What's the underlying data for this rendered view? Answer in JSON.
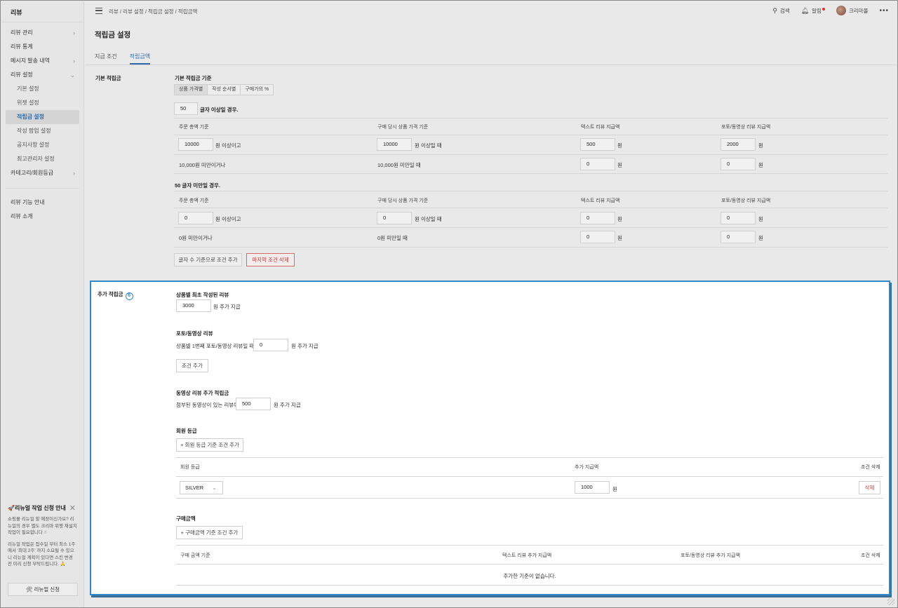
{
  "app": {
    "brand": "리뷰"
  },
  "sidebar": {
    "items": [
      {
        "label": "리뷰 관리",
        "chevron": "›"
      },
      {
        "label": "리뷰 통계"
      },
      {
        "label": "메시지 발송 내역",
        "chevron": "›"
      },
      {
        "label": "리뷰 설정",
        "chevron": "⌄"
      },
      {
        "label": "기본 설정"
      },
      {
        "label": "위젯 설정"
      },
      {
        "label": "적립금 설정"
      },
      {
        "label": "작성 팝업 설정"
      },
      {
        "label": "공지사항 설정"
      },
      {
        "label": "최고관리자 설정"
      },
      {
        "label": "카테고리/회원등급",
        "chevron": "›"
      }
    ],
    "bottom_items": [
      {
        "label": "리뷰 기능 안내"
      },
      {
        "label": "리뷰 소개"
      }
    ],
    "promo": {
      "title": "🚀리뉴얼 작업 신청 안내",
      "close": "✕",
      "text1": "쇼핑몰 리뉴얼 할 예정이신가요? 리뉴얼의 경우 별도 크리마 위젯 재설치 작업이 필요합니다 ☝",
      "text2": "리뉴얼 작업은 접수일 부터 최소 1주에서 '최대 2주' 까지 소요될 수 있으니 리뉴얼 계획이 있다면 스킨 변경 전 미리 신청 부탁드립니다. 🙏",
      "button": "🛠 리뉴얼 신청"
    }
  },
  "topbar": {
    "breadcrumb": "리뷰 / 리뷰 설정 / 적립금 설정 / 적립금액",
    "search": "검색",
    "alerts": "알림",
    "user": "크리마몰",
    "more": "•••"
  },
  "page": {
    "title": "적립금 설정",
    "tabs": [
      "지급 조건",
      "적립금액"
    ]
  },
  "basic": {
    "section_label": "기본 적립금",
    "criteria_title": "기본 적립금 기준",
    "segments": [
      "상품 가격별",
      "작성 순서별",
      "구매가의 %"
    ],
    "char_count": "50",
    "over_label": "글자 이상일 경우.",
    "under_label": "50 글자 미만일 경우.",
    "columns": [
      "주문 총액 기준",
      "구매 당시 상품 가격 기준",
      "텍스트 리뷰 지급액",
      "포토/동영상 리뷰 지급액"
    ],
    "over_rows": {
      "r1": {
        "order": "10000",
        "order_suffix": "원 이상이고",
        "price": "10000",
        "price_suffix": "원 이상일 때",
        "text": "500",
        "photo": "2000",
        "won": "원"
      },
      "r2": {
        "order_text": "10,000원 미만이거나",
        "price_text": "10,000원 미만일 때",
        "text": "0",
        "photo": "0",
        "won": "원"
      }
    },
    "under_rows": {
      "r1": {
        "order": "0",
        "order_suffix": "원 이상이고",
        "price": "0",
        "price_suffix": "원 이상일 때",
        "text": "0",
        "photo": "0",
        "won": "원"
      },
      "r2": {
        "order_text": "0원 미만이거나",
        "price_text": "0원 미만일 때",
        "text": "0",
        "photo": "0",
        "won": "원"
      }
    },
    "add_btn": "글자 수 기준으로 조건 추가",
    "delete_btn": "마지막 조건 삭제"
  },
  "extra": {
    "section_label": "추가 적립금",
    "badge": "6",
    "first_review": {
      "title": "상품별 최초 작성된 리뷰",
      "value": "3000",
      "suffix": "원 추가 지급"
    },
    "photo_review": {
      "title": "포토/동영상 리뷰",
      "prefix": "상품별 1번째 포토/동영상 리뷰일 때,",
      "value": "0",
      "suffix": "원 추가 지급",
      "add_btn": "조건 추가"
    },
    "video_review": {
      "title": "동영상 리뷰 추가 적립금",
      "prefix": "첨부된 동영상이 있는 리뷰에",
      "value": "500",
      "suffix": "원 추가 지급"
    },
    "member_grade": {
      "title": "회원 등급",
      "add_btn": "+ 회원 등급 기준 조건 추가",
      "columns": [
        "회원 등급",
        "추가 지급액",
        "조건 삭제"
      ],
      "row": {
        "grade": "SILVER",
        "amount": "1000",
        "won": "원",
        "delete": "삭제"
      }
    },
    "purchase": {
      "title": "구매금액",
      "add_btn": "+ 구매금액 기준 조건 추가",
      "columns": [
        "구매 금액 기준",
        "텍스트 리뷰 추가 지급액",
        "포토/동영상 리뷰 추가 지급액",
        "조건 삭제"
      ],
      "empty": "추가한 기준이 없습니다."
    }
  },
  "colors": {
    "accent": "#2f6bab",
    "highlight_border": "#2f87c8",
    "danger": "#cc3333"
  }
}
